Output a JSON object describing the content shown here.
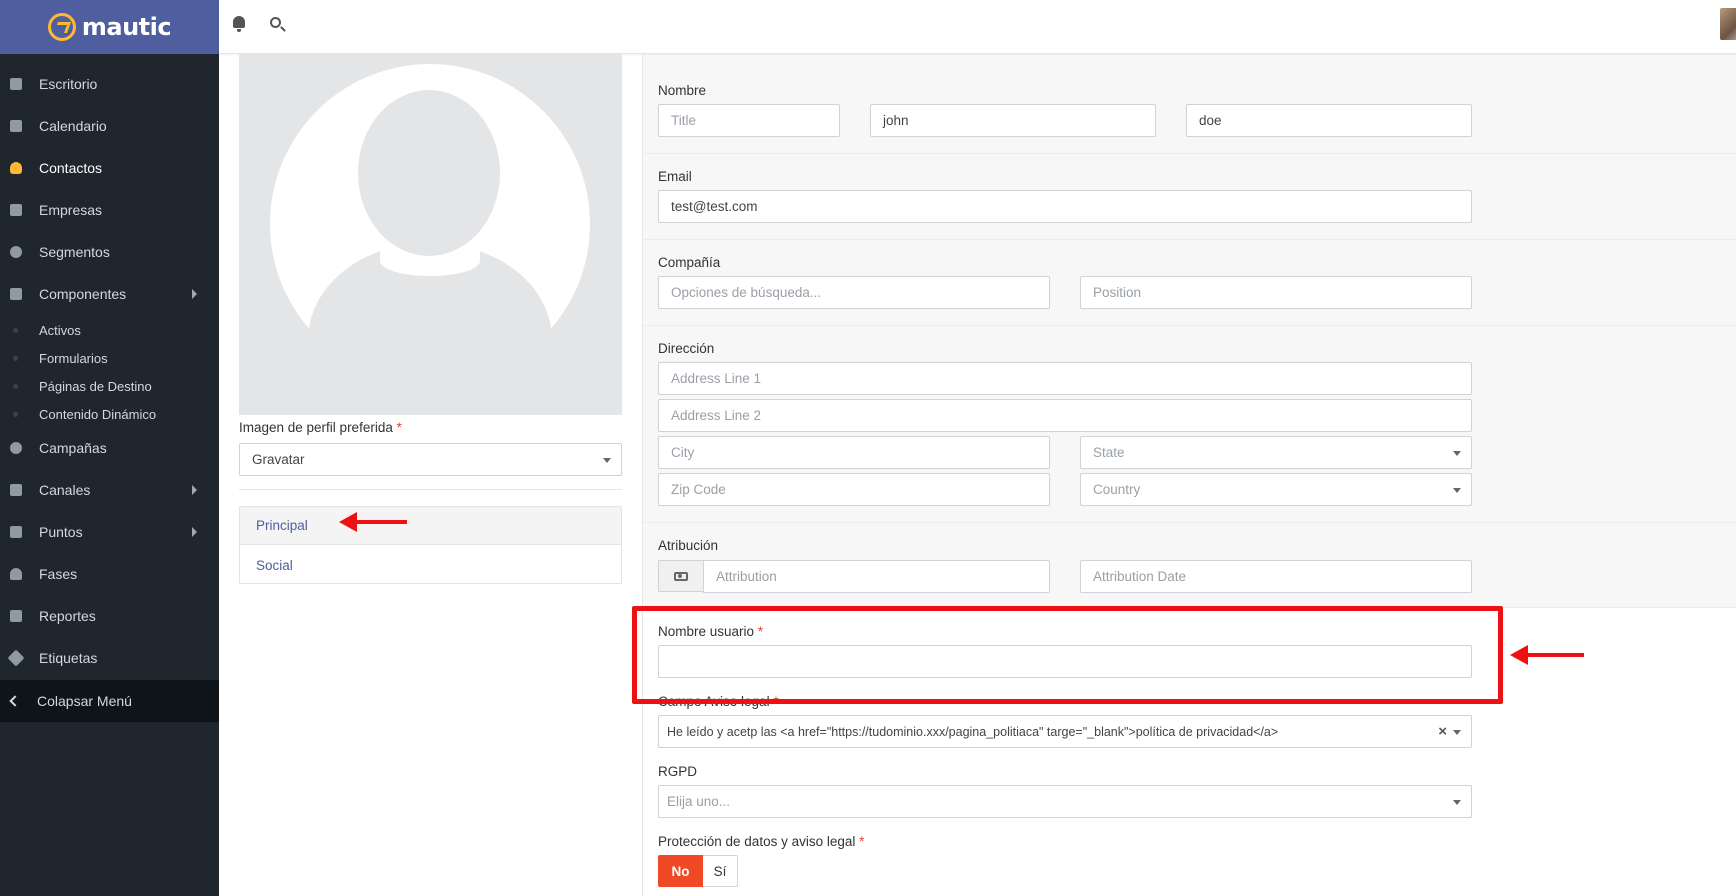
{
  "brand": {
    "name": "mautic"
  },
  "sidebar": {
    "items": [
      {
        "label": "Escritorio",
        "icon": "dashboard-icon"
      },
      {
        "label": "Calendario",
        "icon": "calendar-icon"
      },
      {
        "label": "Contactos",
        "icon": "user-icon",
        "active": true
      },
      {
        "label": "Empresas",
        "icon": "building-icon"
      },
      {
        "label": "Segmentos",
        "icon": "pie-chart-icon"
      },
      {
        "label": "Componentes",
        "icon": "puzzle-icon",
        "expandable": true
      },
      {
        "label": "Campañas",
        "icon": "clock-icon"
      },
      {
        "label": "Canales",
        "icon": "rss-icon",
        "expandable": true
      },
      {
        "label": "Puntos",
        "icon": "calculator-icon",
        "expandable": true
      },
      {
        "label": "Fases",
        "icon": "tachometer-icon"
      },
      {
        "label": "Reportes",
        "icon": "line-chart-icon"
      },
      {
        "label": "Etiquetas",
        "icon": "tag-icon"
      }
    ],
    "subitems": [
      "Activos",
      "Formularios",
      "Páginas de Destino",
      "Contenido Dinámico"
    ],
    "collapse_label": "Colapsar Menú"
  },
  "profile": {
    "preferred_image_label": "Imagen de perfil preferida",
    "preferred_image_value": "Gravatar",
    "tabs": [
      "Principal",
      "Social"
    ]
  },
  "form": {
    "name_label": "Nombre",
    "title_placeholder": "Title",
    "firstname_value": "john",
    "lastname_value": "doe",
    "email_label": "Email",
    "email_value": "test@test.com",
    "company_label": "Compañía",
    "company_placeholder": "Opciones de búsqueda...",
    "position_placeholder": "Position",
    "address_label": "Dirección",
    "address1_placeholder": "Address Line 1",
    "address2_placeholder": "Address Line 2",
    "city_placeholder": "City",
    "state_placeholder": "State",
    "zip_placeholder": "Zip Code",
    "country_placeholder": "Country",
    "attribution_label": "Atribución",
    "attribution_placeholder": "Attribution",
    "attribution_date_placeholder": "Attribution Date",
    "username_label": "Nombre usuario",
    "username_value": "",
    "legal_label": "Campo Aviso legal",
    "legal_value": "He leído y acetp las <a href=\"https://tudominio.xxx/pagina_politiaca\" targe=\"_blank\">política de privacidad</a>",
    "rgpd_label": "RGPD",
    "rgpd_placeholder": "Elija uno...",
    "protection_label": "Protección de datos y aviso legal",
    "toggle_no": "No",
    "toggle_si": "Sí",
    "required_mark": "*"
  },
  "colors": {
    "accent": "#4e5e9e",
    "sidebar": "#1f262d",
    "highlight": "#ef1111",
    "toggle_active": "#ef4a25",
    "brand_mark": "#fdb933"
  }
}
